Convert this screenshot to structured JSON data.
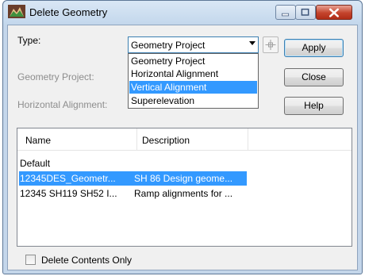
{
  "window": {
    "title": "Delete Geometry"
  },
  "form": {
    "type_label": "Type:",
    "type_value": "Geometry Project",
    "geometry_project_label": "Geometry Project:",
    "horizontal_alignment_label": "Horizontal Alignment:"
  },
  "dropdown": {
    "items": [
      {
        "label": "Geometry Project"
      },
      {
        "label": "Horizontal Alignment"
      },
      {
        "label": "Vertical Alignment"
      },
      {
        "label": "Superelevation"
      }
    ]
  },
  "buttons": {
    "apply": "Apply",
    "close": "Close",
    "help": "Help"
  },
  "list": {
    "headers": {
      "name": "Name",
      "description": "Description"
    },
    "rows": [
      {
        "name": "Default",
        "description": ""
      },
      {
        "name": "12345DES_Geometr...",
        "description": "SH 86 Design geome..."
      },
      {
        "name": "12345 SH119 SH52 I...",
        "description": "Ramp alignments for ..."
      }
    ]
  },
  "options": {
    "delete_contents_only": "Delete Contents Only"
  },
  "colors": {
    "selection": "#3399ff",
    "window_frame": "#c4d6ea",
    "close_button": "#c4432c"
  }
}
